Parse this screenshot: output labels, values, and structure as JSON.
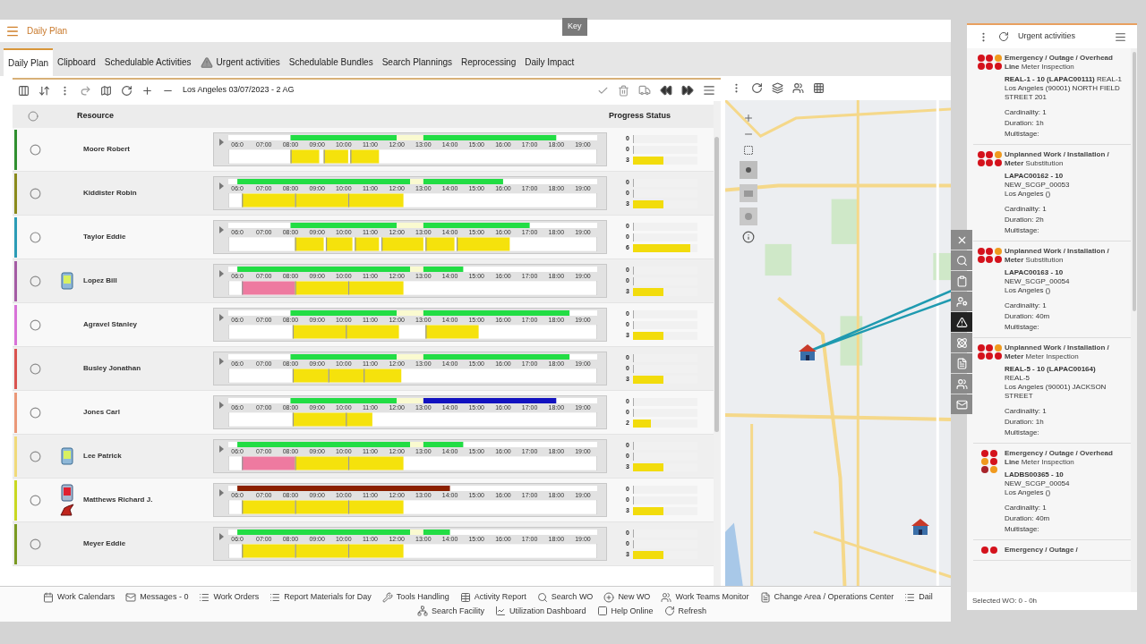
{
  "header": {
    "title": "Daily Plan",
    "tooltip": "Key"
  },
  "tabs": [
    {
      "label": "Daily Plan",
      "selected": true
    },
    {
      "label": "Clipboard",
      "selected": false
    },
    {
      "label": "Schedulable Activities",
      "selected": false
    },
    {
      "label": "Urgent activities",
      "selected": false,
      "kind": "warning"
    },
    {
      "label": "Schedulable Bundles",
      "selected": false
    },
    {
      "label": "Search Plannings",
      "selected": false
    },
    {
      "label": "Reprocessing",
      "selected": false
    },
    {
      "label": "Daily Impact",
      "selected": false
    }
  ],
  "toolbar": {
    "area": "Los Angeles 03/07/2023 - 2 AG"
  },
  "table": {
    "select_all": {
      "checked": false
    },
    "columns": [
      "Resource",
      "Progress Status"
    ],
    "rows": [
      {
        "name": "Moore Robert",
        "selected": false,
        "color": "#2f8f2f",
        "devices": [],
        "hours": [
          "06:0",
          "07:00",
          "08:00",
          "09:00",
          "10:00",
          "11:00",
          "12:00",
          "13:00",
          "14:00",
          "15:00",
          "16:00",
          "17:00",
          "18:00",
          "19:00"
        ],
        "progress": [
          {
            "count": "0",
            "level": 0
          },
          {
            "count": "0",
            "level": 0
          },
          {
            "count": "3",
            "level": 0.47
          }
        ]
      },
      {
        "name": "Kiddister Robin",
        "selected": false,
        "color": "#8a8a1c",
        "devices": [],
        "hours": [
          "06:0",
          "07:00",
          "08:00",
          "09:00",
          "10:00",
          "11:00",
          "12:00",
          "13:00",
          "14:00",
          "15:00",
          "16:00",
          "17:00",
          "18:00",
          "19:00"
        ],
        "progress": [
          {
            "count": "0",
            "level": 0
          },
          {
            "count": "0",
            "level": 0
          },
          {
            "count": "3",
            "level": 0.47
          }
        ]
      },
      {
        "name": "Taylor Eddie",
        "selected": false,
        "color": "#2b9cb6",
        "devices": [],
        "hours": [
          "06:0",
          "07:00",
          "08:00",
          "09:00",
          "10:00",
          "11:00",
          "12:00",
          "13:00",
          "14:00",
          "15:00",
          "16:00",
          "17:00",
          "18:00",
          "19:00"
        ],
        "progress": [
          {
            "count": "0",
            "level": 0
          },
          {
            "count": "0",
            "level": 0
          },
          {
            "count": "6",
            "level": 0.89
          }
        ]
      },
      {
        "name": "Lopez Bill",
        "selected": false,
        "color": "#a45ca4",
        "devices": [
          {
            "kind": "phone"
          }
        ],
        "hours": [
          "06:0",
          "07:00",
          "08:00",
          "09:00",
          "10:00",
          "11:00",
          "12:00",
          "13:00",
          "14:00",
          "15:00",
          "16:00",
          "17:00",
          "18:00",
          "19:00"
        ],
        "progress": [
          {
            "count": "0",
            "level": 0
          },
          {
            "count": "0",
            "level": 0
          },
          {
            "count": "3",
            "level": 0.47
          }
        ]
      },
      {
        "name": "Agravel Stanley",
        "selected": false,
        "color": "#d872d8",
        "devices": [],
        "hours": [
          "06:0",
          "07:00",
          "08:00",
          "09:00",
          "10:00",
          "11:00",
          "12:00",
          "13:00",
          "14:00",
          "15:00",
          "16:00",
          "17:00",
          "18:00",
          "19:00"
        ],
        "progress": [
          {
            "count": "0",
            "level": 0
          },
          {
            "count": "0",
            "level": 0
          },
          {
            "count": "3",
            "level": 0.47
          }
        ]
      },
      {
        "name": "Busley Jonathan",
        "selected": false,
        "color": "#d9534f",
        "devices": [],
        "hours": [
          "06:0",
          "07:00",
          "08:00",
          "09:00",
          "10:00",
          "11:00",
          "12:00",
          "13:00",
          "14:00",
          "15:00",
          "16:00",
          "17:00",
          "18:00",
          "19:00"
        ],
        "progress": [
          {
            "count": "0",
            "level": 0
          },
          {
            "count": "0",
            "level": 0
          },
          {
            "count": "3",
            "level": 0.47
          }
        ]
      },
      {
        "name": "Jones Carl",
        "selected": false,
        "color": "#eb9878",
        "devices": [],
        "hours": [
          "06:0",
          "07:00",
          "08:00",
          "09:00",
          "10:00",
          "11:00",
          "12:00",
          "13:00",
          "14:00",
          "15:00",
          "16:00",
          "17:00",
          "18:00",
          "19:00"
        ],
        "progress": [
          {
            "count": "0",
            "level": 0
          },
          {
            "count": "0",
            "level": 0
          },
          {
            "count": "2",
            "level": 0.28
          }
        ]
      },
      {
        "name": "Lee Patrick",
        "selected": false,
        "color": "#f0da7a",
        "devices": [
          {
            "kind": "phone"
          }
        ],
        "hours": [
          "06:0",
          "07:00",
          "08:00",
          "09:00",
          "10:00",
          "11:00",
          "12:00",
          "13:00",
          "14:00",
          "15:00",
          "16:00",
          "17:00",
          "18:00",
          "19:00"
        ],
        "progress": [
          {
            "count": "0",
            "level": 0
          },
          {
            "count": "0",
            "level": 0
          },
          {
            "count": "3",
            "level": 0.47
          }
        ]
      },
      {
        "name": "Matthews Richard J.",
        "selected": false,
        "color": "#c9d822",
        "devices": [
          {
            "kind": "phone_alert"
          },
          {
            "kind": "tool"
          }
        ],
        "hours": [
          "06:0",
          "07:00",
          "08:00",
          "09:00",
          "10:00",
          "11:00",
          "12:00",
          "13:00",
          "14:00",
          "15:00",
          "16:00",
          "17:00",
          "18:00",
          "19:00"
        ],
        "progress": [
          {
            "count": "0",
            "level": 0
          },
          {
            "count": "0",
            "level": 0
          },
          {
            "count": "3",
            "level": 0.47
          }
        ]
      },
      {
        "name": "Meyer Eddie",
        "selected": false,
        "color": "#7a9a22",
        "devices": [],
        "hours": [
          "06:0",
          "07:00",
          "08:00",
          "09:00",
          "10:00",
          "11:00",
          "12:00",
          "13:00",
          "14:00",
          "15:00",
          "16:00",
          "17:00",
          "18:00",
          "19:00"
        ],
        "progress": [
          {
            "count": "0",
            "level": 0
          },
          {
            "count": "0",
            "level": 0
          },
          {
            "count": "3",
            "level": 0.47
          }
        ]
      }
    ]
  },
  "side_tools": [
    {
      "kind": "close",
      "selected": false
    },
    {
      "kind": "search",
      "selected": false
    },
    {
      "kind": "clipboard",
      "selected": false
    },
    {
      "kind": "user",
      "selected": false
    },
    {
      "kind": "warning",
      "selected": true
    },
    {
      "kind": "atom",
      "selected": false
    },
    {
      "kind": "document",
      "selected": false
    },
    {
      "kind": "team",
      "selected": false
    },
    {
      "kind": "mail",
      "selected": false
    }
  ],
  "bottom_bar": [
    [
      {
        "label": "Work Calendars",
        "kind": "calendar"
      },
      {
        "label": "Messages - 0",
        "kind": "mail"
      },
      {
        "label": "Work Orders",
        "kind": "list"
      },
      {
        "label": "Report Materials for Day",
        "kind": "list"
      },
      {
        "label": "Tools Handling",
        "kind": "wrench"
      },
      {
        "label": "Activity Report",
        "kind": "table"
      },
      {
        "label": "Search WO",
        "kind": "search"
      },
      {
        "label": "New WO",
        "kind": "plus"
      },
      {
        "label": "Work Teams Monitor",
        "kind": "team"
      },
      {
        "label": "Change Area / Operations Center",
        "kind": "document"
      },
      {
        "label": "Dail",
        "kind": "list"
      }
    ],
    [
      {
        "label": "Search Facility",
        "kind": "network"
      },
      {
        "label": "Utilization Dashboard",
        "kind": "chart"
      },
      {
        "label": "Help Online",
        "kind": "checkbox"
      },
      {
        "label": "Refresh",
        "kind": "refresh"
      }
    ]
  ],
  "urgent_panel": {
    "title": "Urgent activities",
    "footer": "Selected WO: 0 - 0h",
    "cards": [
      {
        "kind": "wide",
        "dots": [
          {
            "color": "#d4121c"
          },
          {
            "color": "#d4121c"
          },
          {
            "color": "#f09a1e"
          },
          {
            "color": "#d4121c"
          },
          {
            "color": "#d4121c"
          },
          {
            "color": "#d4121c"
          }
        ],
        "title": "**Emergency / Outage / Overhead Line** Meter Inspection",
        "lines": [
          "**REAL-1 - 10 (LAPAC00111)** REAL-1",
          "Los Angeles (90001) NORTH FIELD STREET 201"
        ],
        "details": [
          "Cardinality: 1",
          "Duration: 1h",
          "Multistage:"
        ]
      },
      {
        "kind": "wide",
        "dots": [
          {
            "color": "#d4121c"
          },
          {
            "color": "#d4121c"
          },
          {
            "color": "#f09a1e"
          },
          {
            "color": "#d4121c"
          },
          {
            "color": "#d4121c"
          },
          {
            "color": "#d4121c"
          }
        ],
        "title": "**Unplanned Work / Installation / Meter** Substitution",
        "lines": [
          "**LAPAC00162 - 10**",
          "NEW_SCGP_00053",
          "Los Angeles ()"
        ],
        "details": [
          "Cardinality: 1",
          "Duration: 2h",
          "Multistage:"
        ]
      },
      {
        "kind": "wide",
        "dots": [
          {
            "color": "#d4121c"
          },
          {
            "color": "#d4121c"
          },
          {
            "color": "#f09a1e"
          },
          {
            "color": "#d4121c"
          },
          {
            "color": "#d4121c"
          },
          {
            "color": "#d4121c"
          }
        ],
        "title": "**Unplanned Work / Installation / Meter** Substitution",
        "lines": [
          "**LAPAC00163 - 10**",
          "NEW_SCGP_00054",
          "Los Angeles ()"
        ],
        "details": [
          "Cardinality: 1",
          "Duration: 40m",
          "Multistage:"
        ]
      },
      {
        "kind": "wide",
        "dots": [
          {
            "color": "#d4121c"
          },
          {
            "color": "#d4121c"
          },
          {
            "color": "#f09a1e"
          },
          {
            "color": "#d4121c"
          },
          {
            "color": "#d4121c"
          },
          {
            "color": "#d4121c"
          }
        ],
        "title": "**Unplanned Work / Installation / Meter** Meter Inspection",
        "lines": [
          "**REAL-5 - 10 (LAPAC00164)**",
          "REAL-5",
          "Los Angeles (90001) JACKSON STREET"
        ],
        "details": [
          "Cardinality: 1",
          "Duration: 1h",
          "Multistage:"
        ]
      },
      {
        "kind": "tall",
        "dots": [
          {
            "color": "#d4121c"
          },
          {
            "color": "#d4121c"
          },
          {
            "color": "#f09a1e"
          },
          {
            "color": "#d4121c"
          },
          {
            "color": "#a8242a"
          },
          {
            "color": "#f09a1e"
          }
        ],
        "title": "**Emergency / Outage / Overhead Line** Meter Inspection",
        "lines": [
          "**LADBS00365 - 10**",
          "NEW_SCGP_00054",
          "Los Angeles ()"
        ],
        "details": [
          "Cardinality: 1",
          "Duration: 40m",
          "Multistage:"
        ]
      },
      {
        "kind": "tall",
        "dots": [
          {
            "color": "#d4121c"
          },
          {
            "color": "#d4121c"
          }
        ],
        "title": "**Emergency / Outage /**"
      }
    ]
  }
}
